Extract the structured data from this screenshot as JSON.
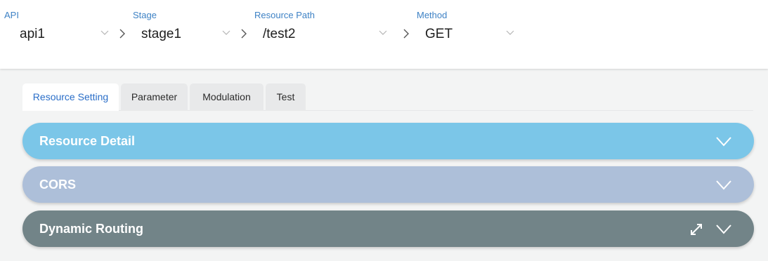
{
  "selectors": [
    {
      "label": "API",
      "value": "api1"
    },
    {
      "label": "Stage",
      "value": "stage1"
    },
    {
      "label": "Resource Path",
      "value": "/test2"
    },
    {
      "label": "Method",
      "value": "GET"
    }
  ],
  "tabs": [
    {
      "label": "Resource Setting",
      "active": true
    },
    {
      "label": "Parameter",
      "active": false
    },
    {
      "label": "Modulation",
      "active": false
    },
    {
      "label": "Test",
      "active": false
    }
  ],
  "panels": [
    {
      "title": "Resource Detail",
      "color": "#7bc6e8"
    },
    {
      "title": "CORS",
      "color": "#adbfd9"
    },
    {
      "title": "Dynamic Routing",
      "color": "#728488"
    }
  ],
  "icons": {
    "dropdown": "chevron-down-icon",
    "separator": "chevron-right-icon",
    "panel_toggle": "chevron-down-icon",
    "expand": "expand-icon"
  },
  "colors": {
    "label_blue": "#3e82c5",
    "active_tab_text": "#2a6ec8",
    "page_background": "#f3f4f4"
  }
}
